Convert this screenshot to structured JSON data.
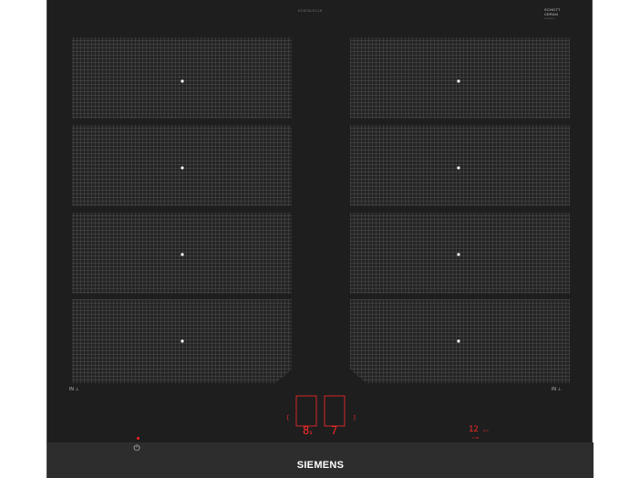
{
  "product": {
    "model_text": "EX675LXC1E",
    "brand_top_line1": "SCHOTT",
    "brand_top_line2": "CERAN",
    "brand_top_sub": "ceramic",
    "logo": "SIEMENS"
  },
  "zones": {
    "left_label": "IN",
    "right_label": "IN"
  },
  "display": {
    "left_power": "8",
    "left_power_sub": "s",
    "right_power": "7",
    "left_level_bracket": "[",
    "right_level_bracket": "]",
    "timer_value": "12",
    "timer_unit": "min",
    "timer_sub": "1:30"
  },
  "colors": {
    "glass": "#1e1e1e",
    "control_strip": "#2d2d2d",
    "led_red": "#ff2a2a",
    "zone_mesh": "#6b6b6b",
    "white": "#ffffff"
  },
  "icons": {
    "power": "power-icon",
    "zone_indicator": "induction-zone-icon"
  }
}
